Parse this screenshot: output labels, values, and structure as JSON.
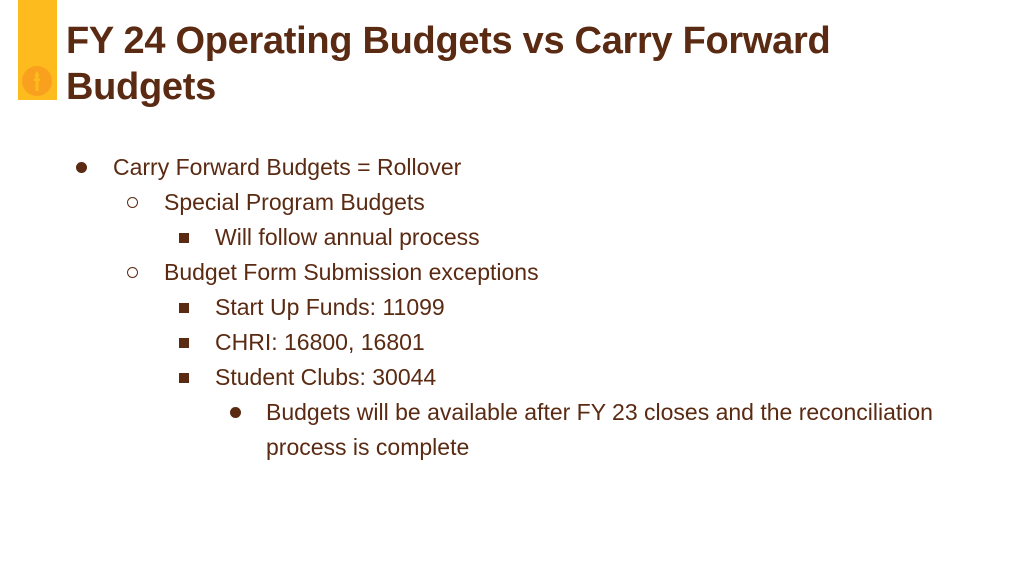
{
  "slide": {
    "title": "FY 24 Operating Budgets vs Carry Forward Budgets",
    "logo_icon": "torch-logo-icon",
    "colors": {
      "accent": "#fdbb1e",
      "logo": "#f9a11e",
      "text": "#5a2a12",
      "background": "#ffffff"
    },
    "bullets": [
      {
        "level": 1,
        "marker": "disc",
        "text": "Carry Forward Budgets = Rollover"
      },
      {
        "level": 2,
        "marker": "circle",
        "text": "Special Program Budgets"
      },
      {
        "level": 3,
        "marker": "square",
        "text": "Will follow annual process"
      },
      {
        "level": 2,
        "marker": "circle",
        "text": "Budget Form Submission exceptions"
      },
      {
        "level": 3,
        "marker": "square",
        "text": "Start Up Funds: 11099"
      },
      {
        "level": 3,
        "marker": "square",
        "text": "CHRI: 16800, 16801"
      },
      {
        "level": 3,
        "marker": "square",
        "text": "Student Clubs: 30044"
      },
      {
        "level": 4,
        "marker": "disc",
        "text": "Budgets will be available after FY 23 closes and the reconciliation process is complete"
      }
    ]
  }
}
